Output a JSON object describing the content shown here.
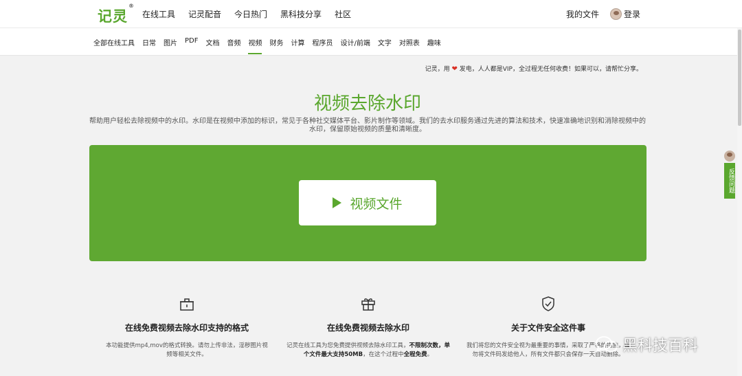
{
  "header": {
    "logo": "记灵",
    "logo_mark": "®",
    "nav": [
      "在线工具",
      "记灵配音",
      "今日热门",
      "黑科技分享",
      "社区"
    ],
    "my_files": "我的文件",
    "login": "登录"
  },
  "categories": {
    "items": [
      "全部在线工具",
      "日常",
      "图片",
      "PDF",
      "文档",
      "音频",
      "视频",
      "财务",
      "计算",
      "程序员",
      "设计/前端",
      "文字",
      "对照表",
      "趣味"
    ],
    "active": "视频"
  },
  "tagline": {
    "before": "记灵，用",
    "heart_icon": "heart-icon",
    "after": "发电，人人都是VIP，全过程无任何收费！如果可以，请帮忙分享。"
  },
  "page": {
    "title": "视频去除水印",
    "description": "帮助用户轻松去除视频中的水印。水印是在视频中添加的标识，常见于各种社交媒体平台、影片制作等领域。我们的去水印服务通过先进的算法和技术，快速准确地识别和消除视频中的水印，保留原始视频的质量和清晰度。"
  },
  "upload": {
    "button_label": "视频文件",
    "accent": "#5fa832"
  },
  "features": [
    {
      "icon": "box-icon",
      "title": "在线免费视频去除水印支持的格式",
      "text": "本功能提供mp4,mov的格式转换。请勿上传非法，淫秽图片视频等相关文件。"
    },
    {
      "icon": "gift-icon",
      "title": "在线免费视频去除水印",
      "text_a": "记灵在线工具为您免费提供视频去除水印工具，",
      "text_b": "不限制次数，单个文件最大支持50MB",
      "text_c": "，在这个过程中",
      "text_d": "全程免费",
      "text_e": "。"
    },
    {
      "icon": "shield-check-icon",
      "title": "关于文件安全这件事",
      "text": "我们将您的文件安全视为最重要的事情，采取了严格的措施，请勿将文件码发给他人，所有文件都只会保存一天自动删除。"
    }
  ],
  "feedback": {
    "label": "反馈问题"
  },
  "watermark": {
    "text": "黑科技百科",
    "icon": "wechat-icon"
  },
  "colors": {
    "brand": "#5aa72e",
    "heart": "#d93025"
  }
}
